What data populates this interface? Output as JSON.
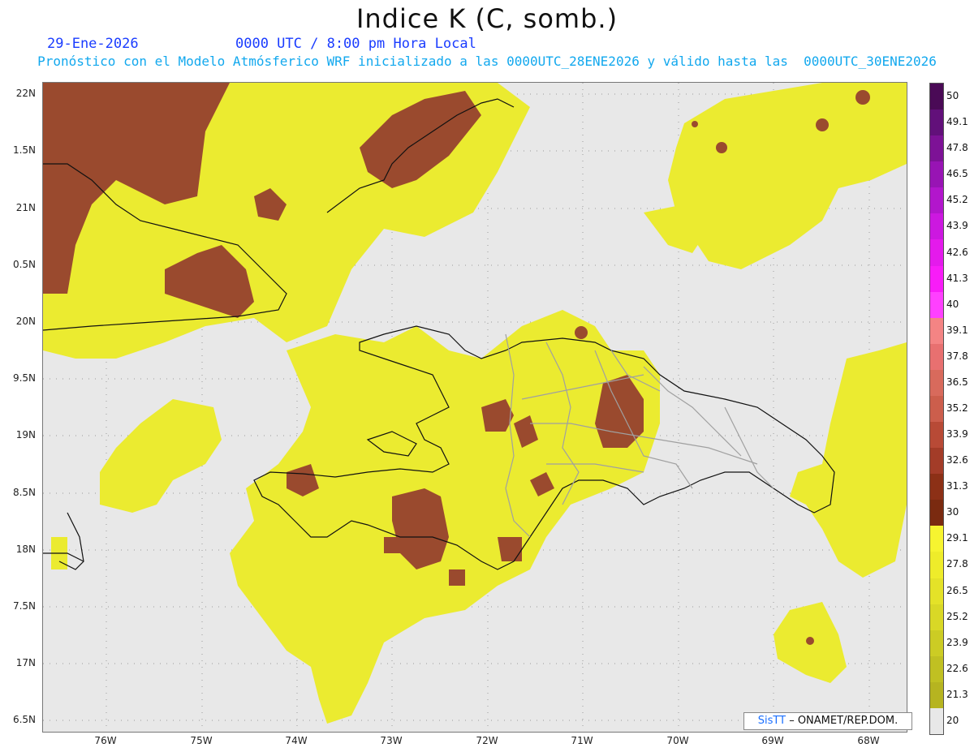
{
  "header": {
    "title": "Indice K (C, somb.)",
    "date": "29-Ene-2026",
    "time": "0000 UTC / 8:00 pm Hora Local",
    "description": "Pronóstico con el Modelo Atmósferico WRF inicializado a las 0000UTC_28ENE2026 y válido hasta las  0000UTC_30ENE2026"
  },
  "axes": {
    "lat_labels": [
      "22N",
      "1.5N",
      "21N",
      "0.5N",
      "20N",
      "9.5N",
      "19N",
      "8.5N",
      "18N",
      "7.5N",
      "17N",
      "6.5N"
    ],
    "lon_labels": [
      "76W",
      "75W",
      "74W",
      "73W",
      "72W",
      "71W",
      "70W",
      "69W",
      "68W"
    ]
  },
  "colorbar": {
    "labels": [
      "50",
      "49.1",
      "47.8",
      "46.5",
      "45.2",
      "43.9",
      "42.6",
      "41.3",
      "40",
      "39.1",
      "37.8",
      "36.5",
      "35.2",
      "33.9",
      "32.6",
      "31.3",
      "30",
      "29.1",
      "27.8",
      "26.5",
      "25.2",
      "23.9",
      "22.6",
      "21.3",
      "20"
    ],
    "colors": [
      "#4a0a56",
      "#62107a",
      "#7d1296",
      "#9814b4",
      "#b216cc",
      "#cc18e0",
      "#e41aec",
      "#f81cf8",
      "#ff40ff",
      "#f48484",
      "#e87070",
      "#d86a5c",
      "#cc5e4c",
      "#b84a36",
      "#a33c28",
      "#8c3016",
      "#7a2a10",
      "#f6f430",
      "#eeec2a",
      "#e4e228",
      "#d9d826",
      "#cccc24",
      "#c0c022",
      "#b6b420",
      "#e8e8e8"
    ]
  },
  "credit": {
    "brand": "SisTT",
    "text": " – ONAMET/REP.DOM."
  },
  "colors": {
    "background": "#e8e8e8",
    "yellow": "#eaea2e",
    "brown": "#9b4a30",
    "border_gray": "#a0a0a0"
  }
}
